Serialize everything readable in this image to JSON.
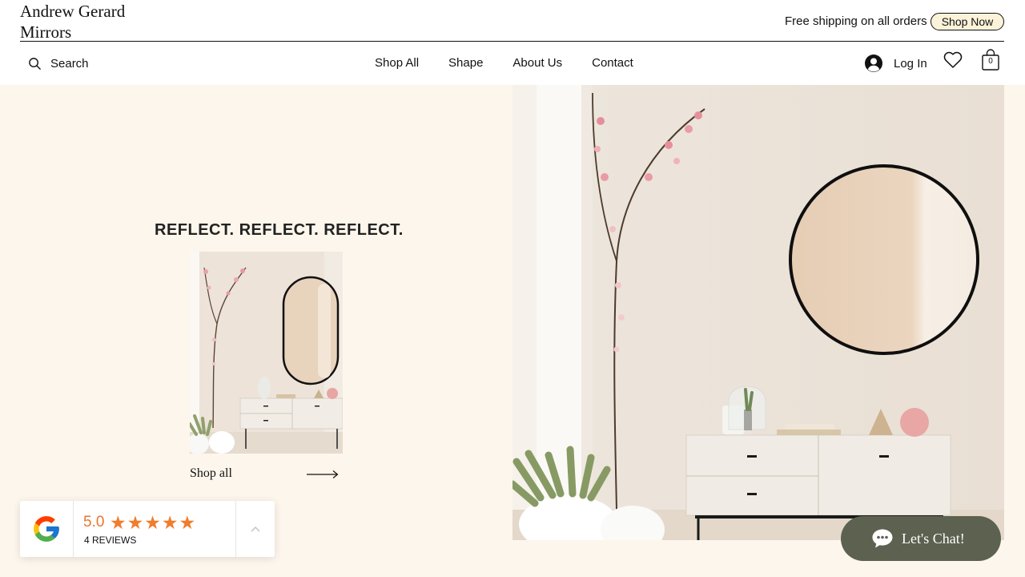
{
  "header": {
    "brand_line1": "Andrew Gerard",
    "brand_line2": "Mirrors",
    "shipping_text": "Free shipping on all orders",
    "shop_now_label": "Shop Now"
  },
  "nav": {
    "search_label": "Search",
    "items": [
      "Shop All",
      "Shape",
      "About Us",
      "Contact"
    ],
    "login_label": "Log In",
    "cart_count": "0"
  },
  "hero": {
    "tagline": "REFLECT. REFLECT. REFLECT.",
    "shop_all_label": "Shop all"
  },
  "reviews": {
    "rating": "5.0",
    "stars": "★★★★★",
    "count_label": "4 REVIEWS"
  },
  "chat": {
    "label": "Let's Chat!"
  },
  "icons": [
    "search-icon",
    "user-icon",
    "heart-icon",
    "shopping-bag-icon",
    "arrow-right-icon",
    "google-logo-icon",
    "chevron-up-icon",
    "chat-bubble-icon"
  ],
  "colors": {
    "page_background": "#fdf6ec",
    "shop_now_fill": "#fbf3d9",
    "star_orange": "#f07c2c",
    "chat_button": "#5d6150"
  }
}
